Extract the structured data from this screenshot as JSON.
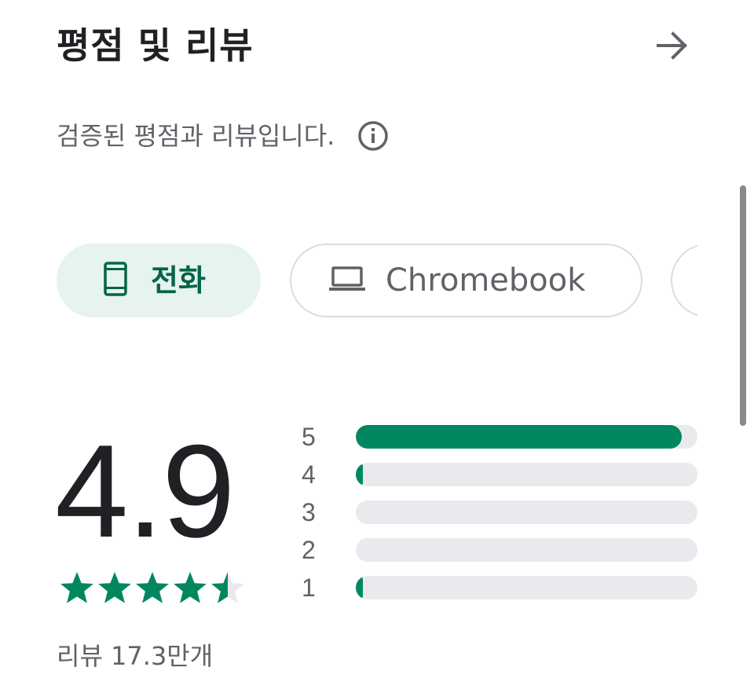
{
  "header": {
    "title": "평점 및 리뷰",
    "arrow_icon": "arrow-right-icon"
  },
  "subtitle": {
    "text": "검증된 평점과 리뷰입니다.",
    "info_icon": "info-icon"
  },
  "device_chips": [
    {
      "label": "전화",
      "icon": "phone-icon",
      "selected": true
    },
    {
      "label": "Chromebook",
      "icon": "laptop-icon",
      "selected": false
    }
  ],
  "rating": {
    "score": "4.9",
    "stars_value": 4.5,
    "review_count": "리뷰 17.3만개"
  },
  "distribution": [
    {
      "label": "5",
      "fraction": 0.955
    },
    {
      "label": "4",
      "fraction": 0.02
    },
    {
      "label": "3",
      "fraction": 0.0
    },
    {
      "label": "2",
      "fraction": 0.0
    },
    {
      "label": "1",
      "fraction": 0.02
    }
  ],
  "colors": {
    "accent": "#01875f",
    "accent_dark": "#056449",
    "chip_selected_bg": "#e6f3ef",
    "track": "#e8eaed",
    "text_primary": "#202124",
    "text_secondary": "#5f6368"
  }
}
